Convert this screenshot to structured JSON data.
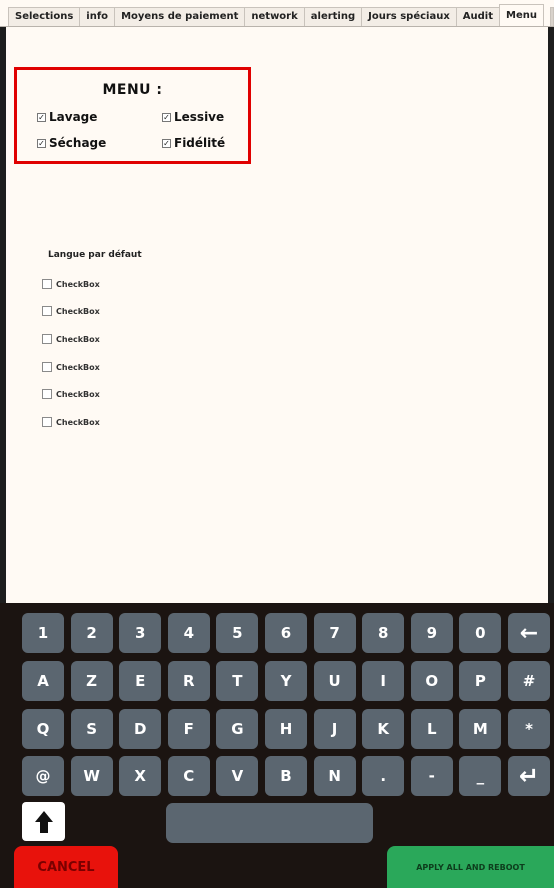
{
  "tabs": [
    {
      "label": "Selections"
    },
    {
      "label": "info"
    },
    {
      "label": "Moyens de paiement"
    },
    {
      "label": "network"
    },
    {
      "label": "alerting"
    },
    {
      "label": "Jours spéciaux"
    },
    {
      "label": "Audit"
    },
    {
      "label": "Menu"
    }
  ],
  "active_tab": "Menu",
  "menu": {
    "title": "MENU :",
    "items": [
      {
        "label": "Lavage",
        "checked": true
      },
      {
        "label": "Lessive",
        "checked": true
      },
      {
        "label": "Séchage",
        "checked": true
      },
      {
        "label": "Fidélité",
        "checked": true
      }
    ],
    "check_glyph": "✓"
  },
  "language": {
    "label": "Langue par défaut",
    "options": [
      {
        "label": "CheckBox",
        "checked": false
      },
      {
        "label": "CheckBox",
        "checked": false
      },
      {
        "label": "CheckBox",
        "checked": false
      },
      {
        "label": "CheckBox",
        "checked": false
      },
      {
        "label": "CheckBox",
        "checked": false
      },
      {
        "label": "CheckBox",
        "checked": false
      }
    ]
  },
  "keyboard": {
    "rows": [
      [
        "1",
        "2",
        "3",
        "4",
        "5",
        "6",
        "7",
        "8",
        "9",
        "0",
        "←"
      ],
      [
        "A",
        "Z",
        "E",
        "R",
        "T",
        "Y",
        "U",
        "I",
        "O",
        "P",
        "#"
      ],
      [
        "Q",
        "S",
        "D",
        "F",
        "G",
        "H",
        "J",
        "K",
        "L",
        "M",
        "*"
      ],
      [
        "@",
        "W",
        "X",
        "C",
        "V",
        "B",
        "N",
        ".",
        "-",
        "_",
        "↵"
      ]
    ],
    "shift_icon": "up-arrow"
  },
  "actions": {
    "cancel_label": "CANCEL",
    "apply_label": "APPLY ALL AND REBOOT"
  },
  "colors": {
    "highlight_border": "#e00000",
    "key_bg": "#5b6670",
    "cancel_bg": "#e8120c",
    "apply_bg": "#2aa85a"
  }
}
